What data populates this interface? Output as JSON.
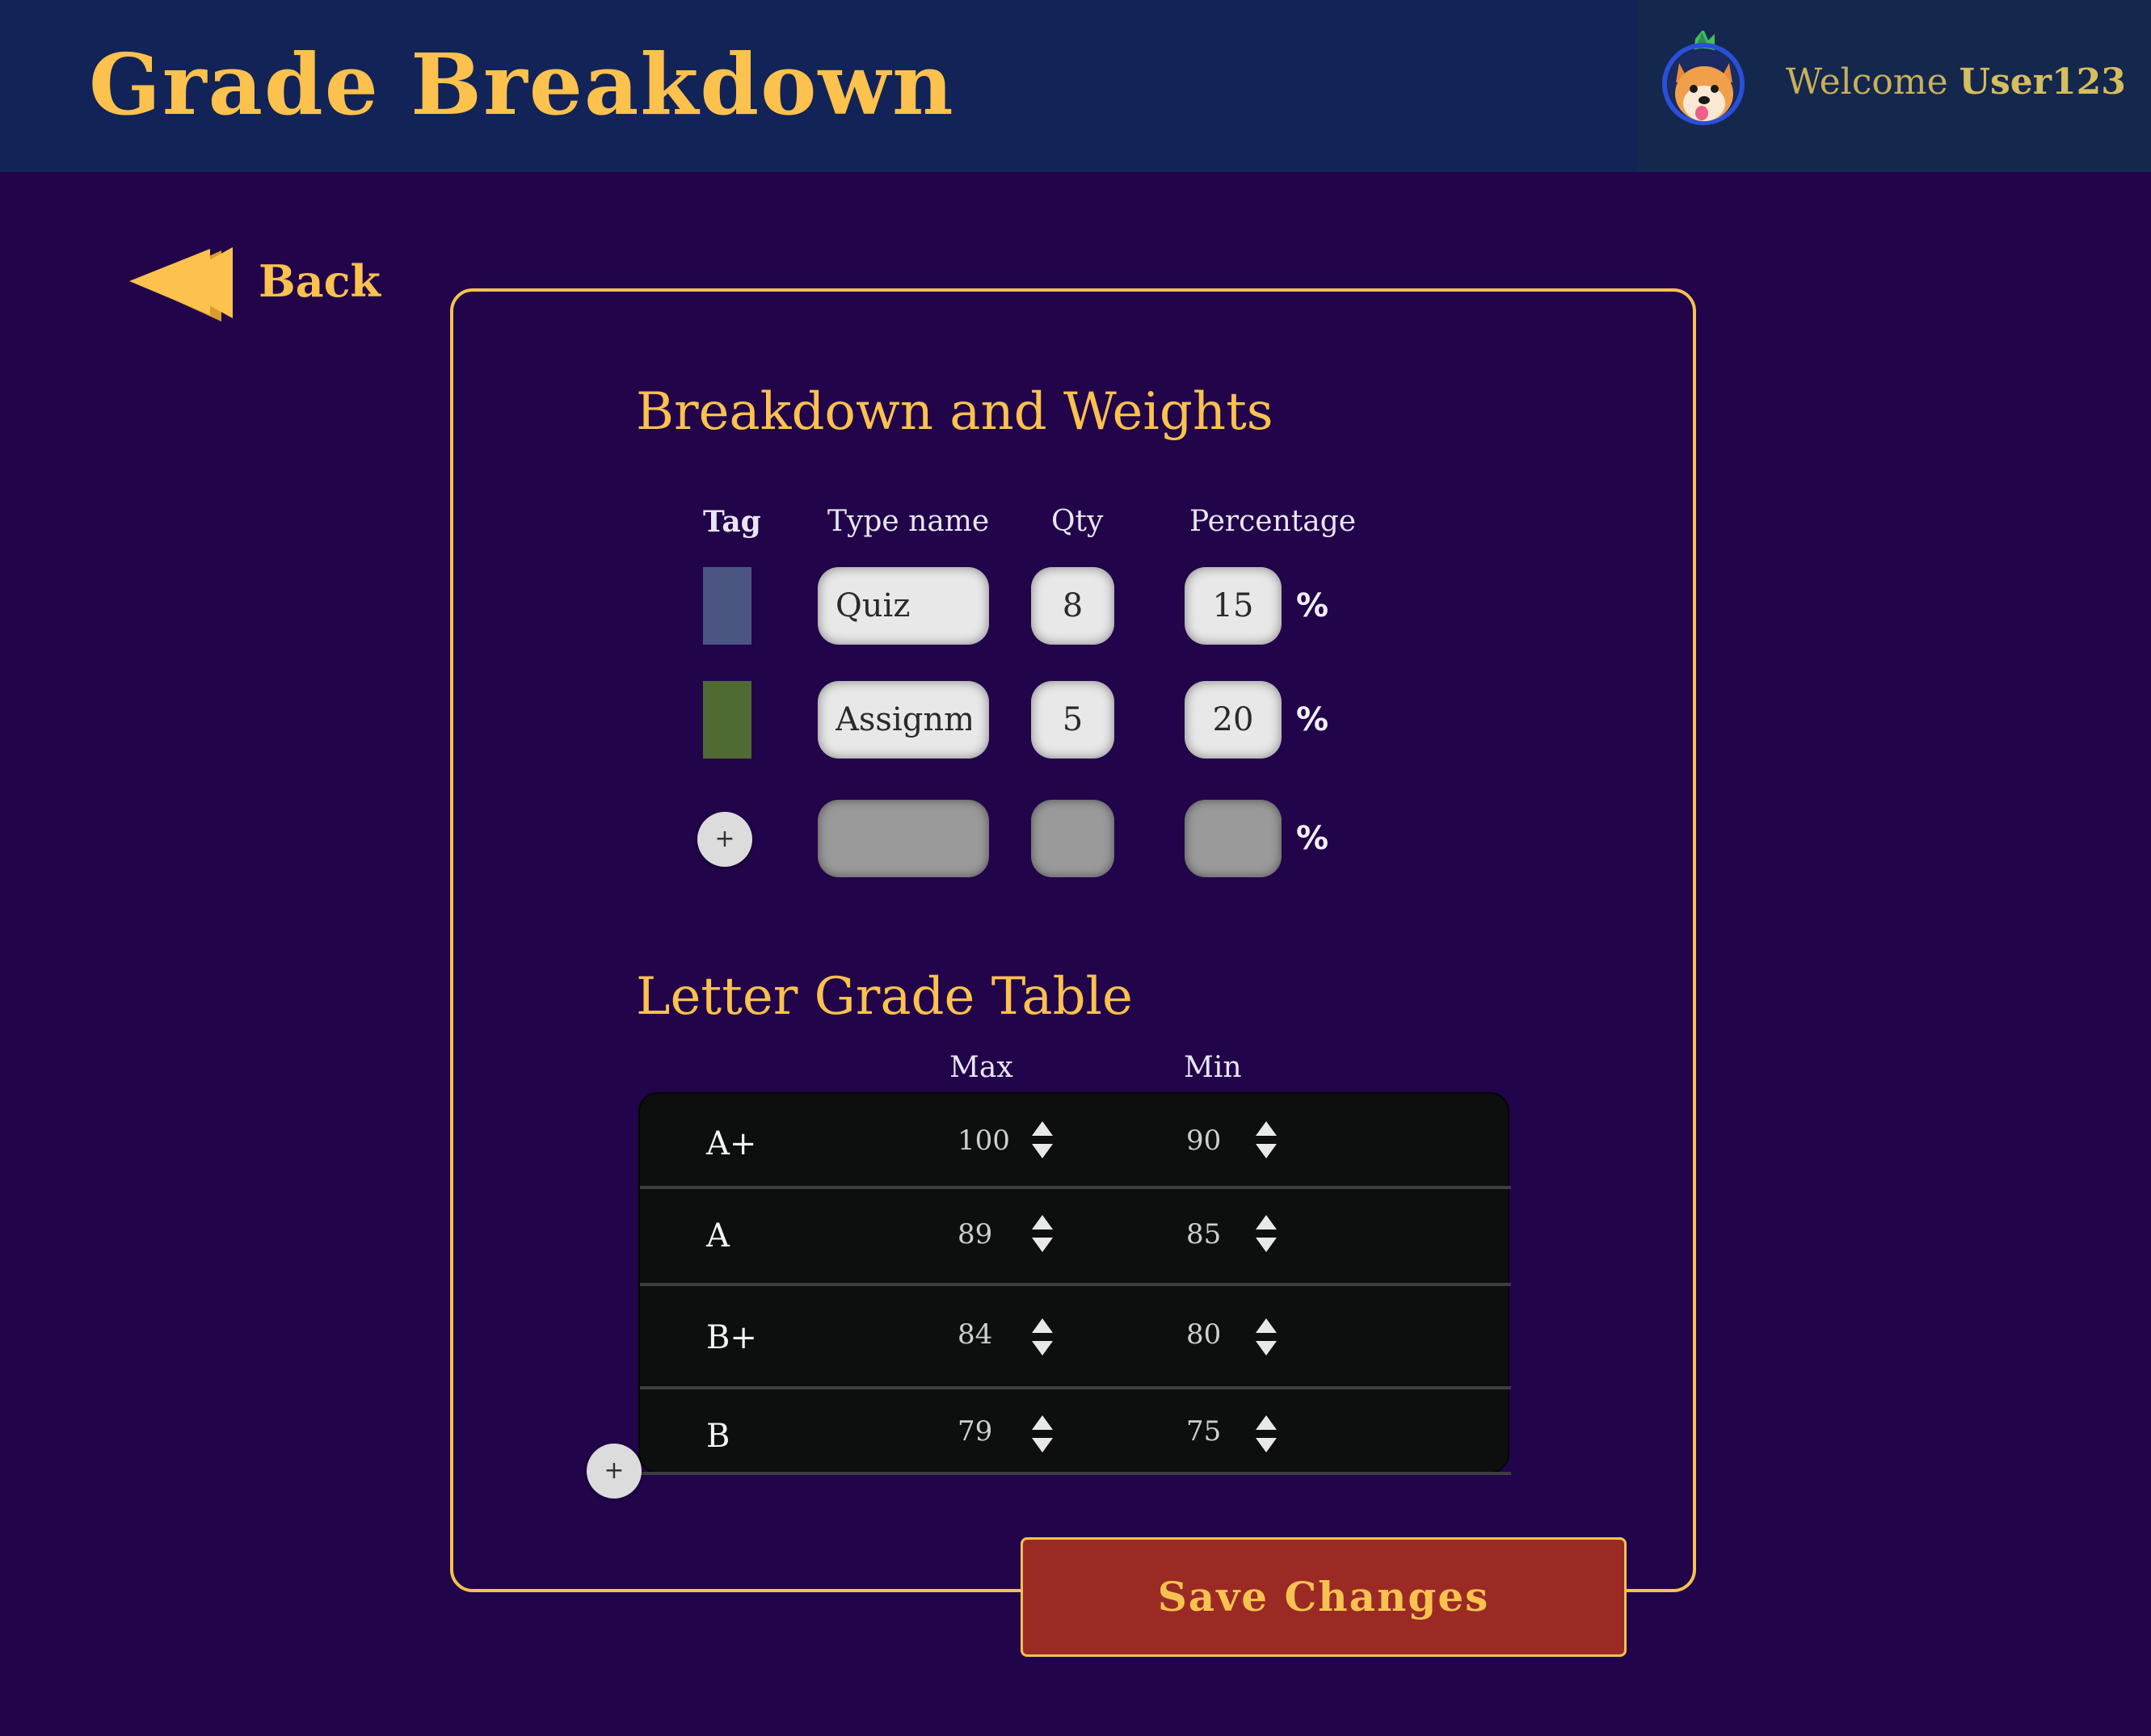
{
  "header": {
    "title": "Grade Breakdown",
    "welcome_prefix": "Welcome",
    "username": "User123"
  },
  "back": {
    "label": "Back"
  },
  "breakdown": {
    "title": "Breakdown and Weights",
    "columns": {
      "tag": "Tag",
      "type_name": "Type name",
      "qty": "Qty",
      "percentage": "Percentage"
    },
    "percent_symbol": "%",
    "rows": [
      {
        "tag_color": "#4a5582",
        "type_name": "Quiz",
        "qty": "8",
        "percentage": "15"
      },
      {
        "tag_color": "#4f6a32",
        "type_name": "Assignm",
        "qty": "5",
        "percentage": "20"
      }
    ],
    "new_row": {
      "add_label": "+",
      "type_name": "",
      "qty": "",
      "percentage": ""
    }
  },
  "letter_grades": {
    "title": "Letter Grade Table",
    "columns": {
      "max": "Max",
      "min": "Min"
    },
    "add_label": "+",
    "rows": [
      {
        "letter": "A+",
        "max": "100",
        "min": "90"
      },
      {
        "letter": "A",
        "max": "89",
        "min": "85"
      },
      {
        "letter": "B+",
        "max": "84",
        "min": "80"
      },
      {
        "letter": "B",
        "max": "79",
        "min": "75"
      }
    ]
  },
  "save": {
    "label": "Save Changes"
  },
  "colors": {
    "background": "#21044a",
    "header": "#122457",
    "accent": "#fdc14d",
    "save_button": "#9b2a25"
  }
}
